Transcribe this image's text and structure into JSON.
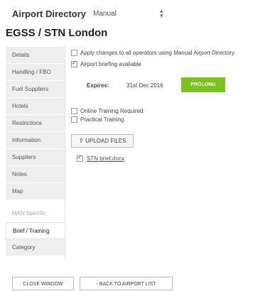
{
  "header": {
    "app_title": "Airport Directory",
    "selected_directory": "Manual",
    "select_icon": "up-down-chevron-icon",
    "airport_title": "EGSS / STN London"
  },
  "sidebar": {
    "items": [
      {
        "label": "Details"
      },
      {
        "label": "Handling / FBO"
      },
      {
        "label": "Fuel Suppliers"
      },
      {
        "label": "Hotels"
      },
      {
        "label": "Restrictions"
      },
      {
        "label": "Information"
      },
      {
        "label": "Suppliers"
      },
      {
        "label": "Notes"
      },
      {
        "label": "Map"
      }
    ],
    "section_label": "MAN Specific",
    "specific_items": [
      {
        "label": "Brief / Training",
        "active": true
      },
      {
        "label": "Category"
      }
    ]
  },
  "main": {
    "apply_all_label": "Apply changes to all operators using Manual Airport Directory",
    "apply_all_checked": false,
    "briefing_label": "Airport briefing available",
    "briefing_checked": true,
    "expires_label": "Expires:",
    "expires_value": "31st Dec 2016",
    "prolong_label": "PROLONG",
    "prolong_color": "#7cc21f",
    "online_training_label": "Online Training Required",
    "online_training_checked": false,
    "practical_training_label": "Practical Training",
    "practical_training_checked": false,
    "upload_label": "UPLOAD FILES",
    "upload_icon": "upload-icon",
    "file_checked": true,
    "file_name": "STN brief.docx"
  },
  "footer": {
    "close_label": "CLOSE WINDOW",
    "back_label": "‹ BACK TO AIRPORT LIST"
  }
}
